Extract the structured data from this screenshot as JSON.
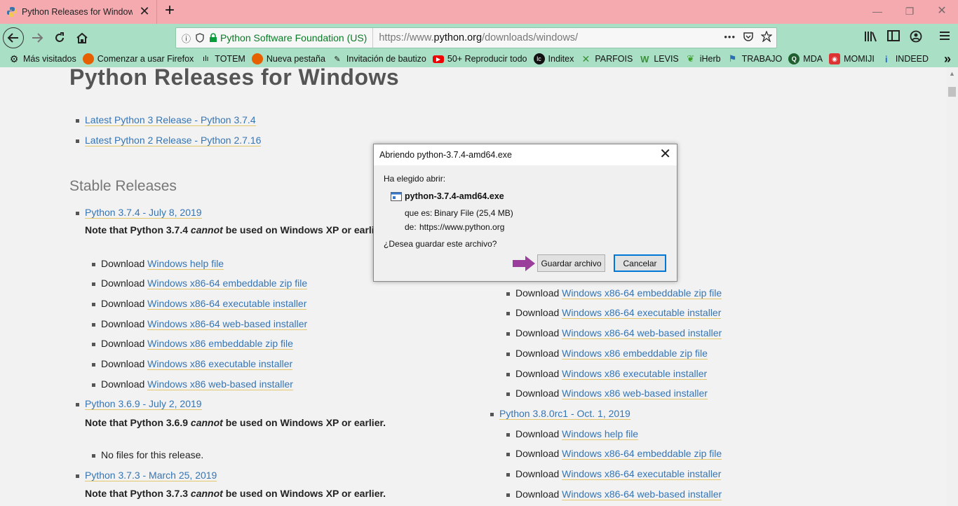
{
  "browser": {
    "tab_title": "Python Releases for Windows |",
    "identity_org": "Python Software Foundation (US)",
    "url_prefix": "https://www.",
    "url_domain": "python.org",
    "url_path": "/downloads/windows/",
    "overflow_dots": "•••"
  },
  "bookmarks": [
    {
      "label": "Más visitados",
      "icon": "gear-icon"
    },
    {
      "label": "Comenzar a usar Firefox",
      "icon": "firefox-icon"
    },
    {
      "label": "TOTEM",
      "icon": "soundwave-icon"
    },
    {
      "label": "Nueva pestaña",
      "icon": "firefox-icon"
    },
    {
      "label": "Invitación de bautizo",
      "icon": "pen-icon"
    },
    {
      "label": "50+ Reproducir todo",
      "icon": "youtube-icon"
    },
    {
      "label": "Inditex",
      "icon": "inditex-icon"
    },
    {
      "label": "PARFOIS",
      "icon": "x-icon"
    },
    {
      "label": "LEVIS",
      "icon": "w-icon"
    },
    {
      "label": "iHerb",
      "icon": "leaf-icon"
    },
    {
      "label": "TRABAJO",
      "icon": "flag-icon"
    },
    {
      "label": "MDA",
      "icon": "q-icon"
    },
    {
      "label": "MOMIJI",
      "icon": "game-icon"
    },
    {
      "label": "INDEED",
      "icon": "indeed-icon"
    }
  ],
  "page": {
    "title": "Python Releases for Windows",
    "top_links": [
      "Latest Python 3 Release - Python 3.7.4",
      "Latest Python 2 Release - Python 2.7.16"
    ],
    "section_title": "Stable Releases",
    "download_word": "Download",
    "releases_left": [
      {
        "title": "Python 3.7.4 - July 8, 2019",
        "note_pre": "Note that Python 3.7.4 ",
        "note_em": "cannot",
        "note_post": " be used on Windows XP or earlier."
      },
      {
        "title": "Python 3.6.9 - July 2, 2019",
        "note_pre": "Note that Python 3.6.9 ",
        "note_em": "cannot",
        "note_post": " be used on Windows XP or earlier."
      },
      {
        "title": "Python 3.7.3 - March 25, 2019",
        "note_pre": "Note that Python 3.7.3 ",
        "note_em": "cannot",
        "note_post": " be used on Windows XP or earlier."
      }
    ],
    "downloads_374": [
      "Windows help file",
      "Windows x86-64 embeddable zip file",
      "Windows x86-64 executable installer",
      "Windows x86-64 web-based installer",
      "Windows x86 embeddable zip file",
      "Windows x86 executable installer",
      "Windows x86 web-based installer"
    ],
    "no_files": "No files for this release.",
    "right_downloads_a": [
      "Windows x86-64 embeddable zip file",
      "Windows x86-64 executable installer",
      "Windows x86-64 web-based installer",
      "Windows x86 embeddable zip file",
      "Windows x86 executable installer",
      "Windows x86 web-based installer"
    ],
    "right_release": "Python 3.8.0rc1 - Oct. 1, 2019",
    "right_downloads_b": [
      "Windows help file",
      "Windows x86-64 embeddable zip file",
      "Windows x86-64 executable installer",
      "Windows x86-64 web-based installer"
    ]
  },
  "dialog": {
    "title": "Abriendo python-3.7.4-amd64.exe",
    "chosen": "Ha elegido abrir:",
    "filename": "python-3.7.4-amd64.exe",
    "type_label": "que es:",
    "type_value": "Binary File (25,4 MB)",
    "from_label": "de:",
    "from_value": "https://www.python.org",
    "question": "¿Desea guardar este archivo?",
    "save_button": "Guardar archivo",
    "cancel_button": "Cancelar",
    "indicator_color": "#9b3d9b"
  }
}
